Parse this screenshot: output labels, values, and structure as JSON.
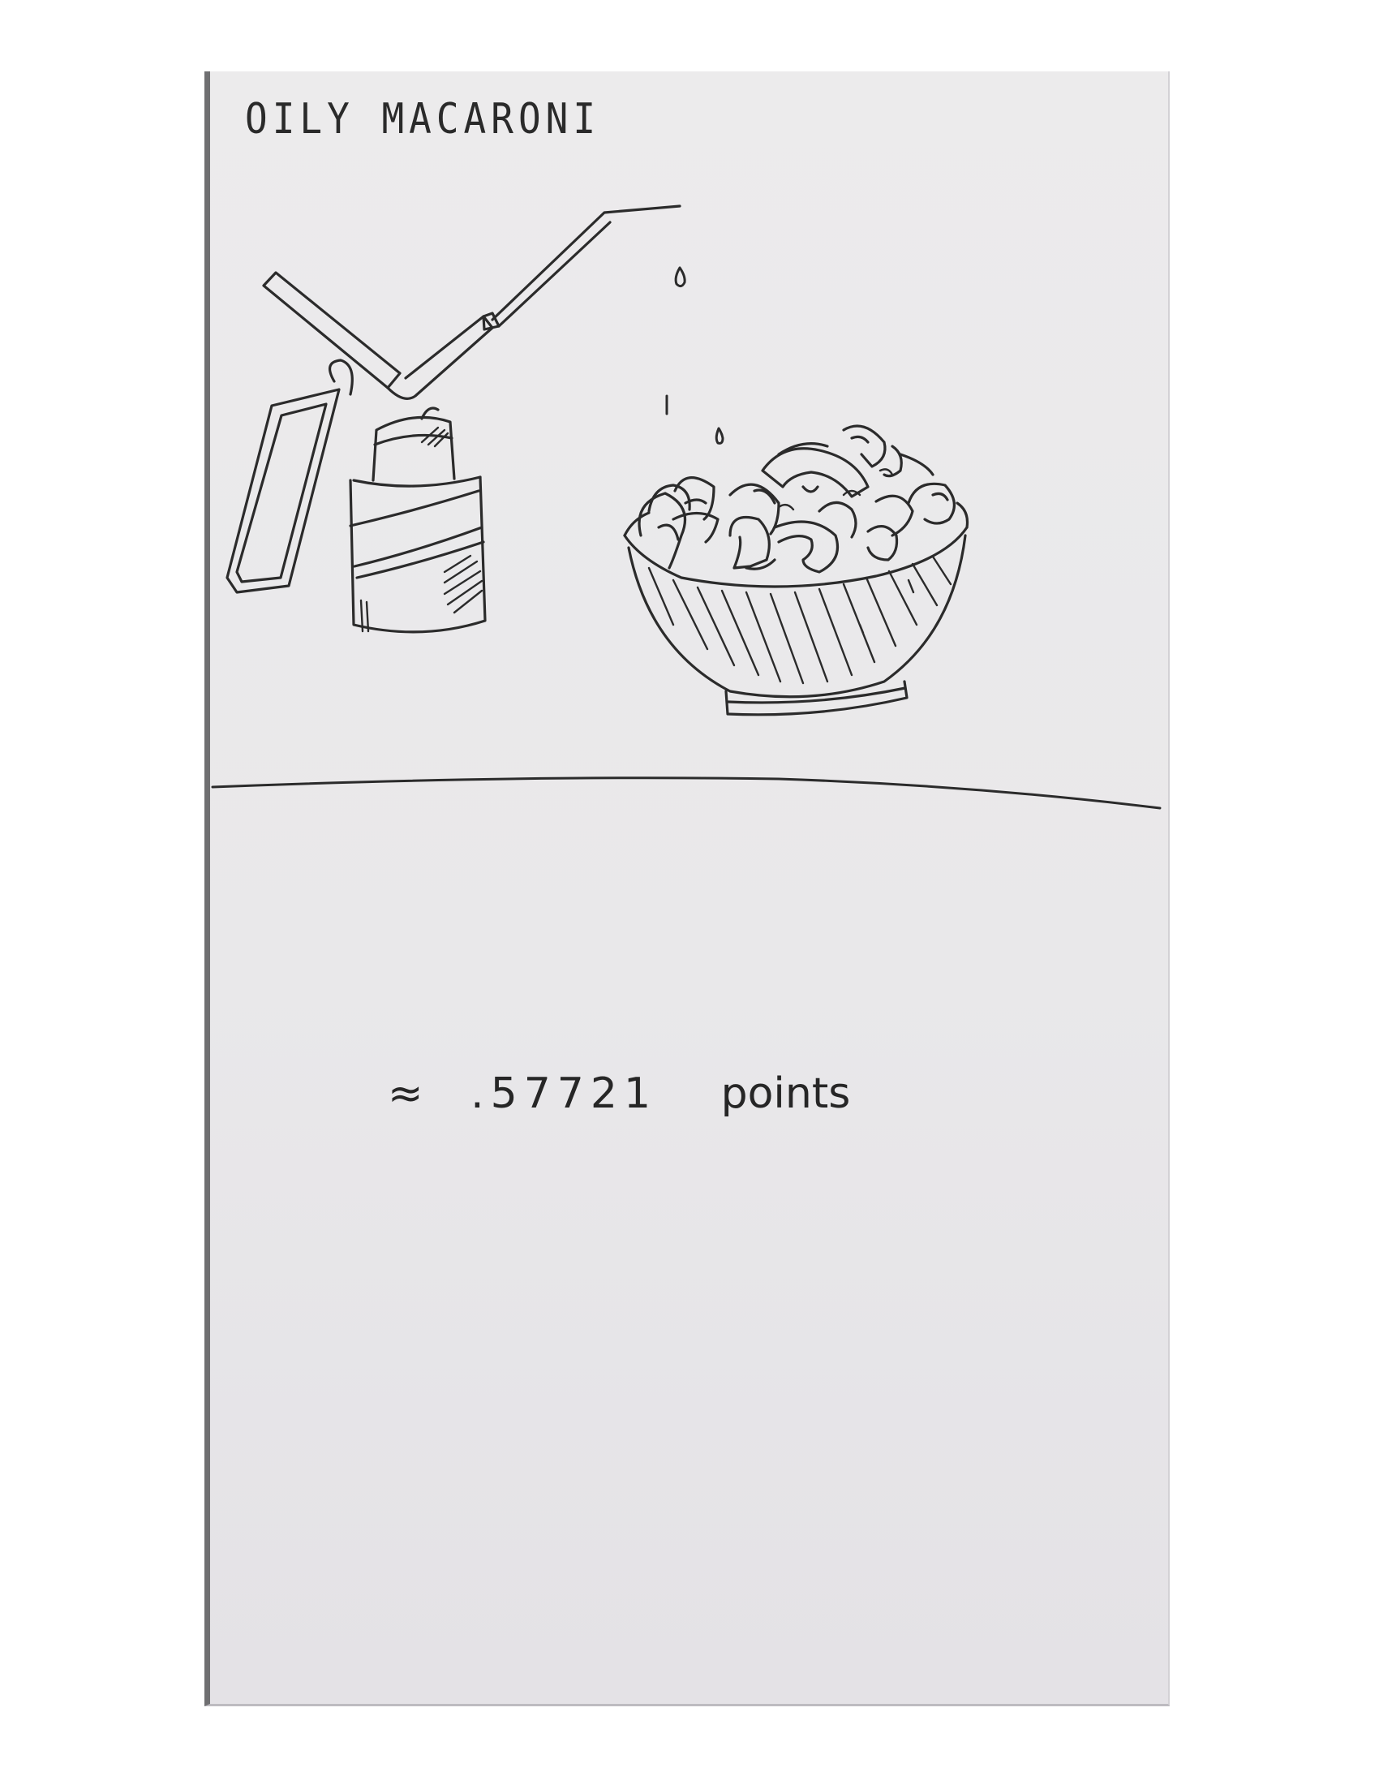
{
  "card": {
    "title": "OILY MACARONI",
    "approx_symbol": "≈",
    "score_value": ".57721",
    "score_unit": "points"
  },
  "illustration": {
    "items": [
      "oil-can-icon",
      "oil-drops-icon",
      "macaroni-bowl-icon",
      "table-edge-line"
    ],
    "ink_color": "#2b2b2b",
    "paper_color": "#ebeaec"
  }
}
